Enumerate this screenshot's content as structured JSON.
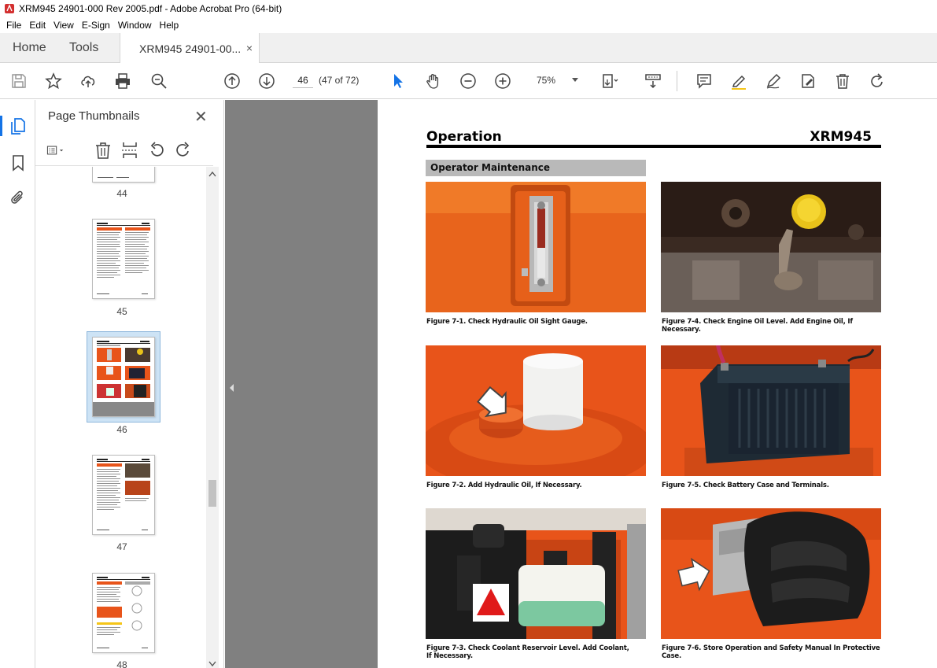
{
  "window": {
    "title": "XRM945 24901-000 Rev 2005.pdf - Adobe Acrobat Pro (64-bit)"
  },
  "menu": [
    "File",
    "Edit",
    "View",
    "E-Sign",
    "Window",
    "Help"
  ],
  "tabs": {
    "home": "Home",
    "tools": "Tools",
    "doc": "XRM945 24901-00...",
    "close": "×"
  },
  "toolbar": {
    "page_number": "46",
    "page_count": "(47 of 72)",
    "zoom": "75%"
  },
  "panel": {
    "title": "Page Thumbnails",
    "close": "✕",
    "thumbnails": [
      {
        "label": "44"
      },
      {
        "label": "45"
      },
      {
        "label": "46",
        "selected": true
      },
      {
        "label": "47"
      },
      {
        "label": "48"
      }
    ]
  },
  "page": {
    "header_left": "Operation",
    "header_right": "XRM945",
    "section": "Operator Maintenance",
    "figures": [
      {
        "caption": "Figure 7-1.  Check Hydraulic Oil Sight Gauge."
      },
      {
        "caption": "Figure 7-4.  Check Engine Oil Level.  Add Engine Oil, If Necessary."
      },
      {
        "caption": "Figure 7-2.  Add Hydraulic Oil, If Necessary."
      },
      {
        "caption": "Figure 7-5.  Check Battery Case and Terminals."
      },
      {
        "caption": "Figure 7-3.  Check Coolant Reservoir Level.  Add Coolant, If Necessary."
      },
      {
        "caption": "Figure 7-6.  Store Operation and Safety Manual In Protective Case."
      }
    ]
  },
  "colors": {
    "accent": "#1473e6",
    "orange": "#e8541a",
    "doc_bg": "#808080"
  }
}
